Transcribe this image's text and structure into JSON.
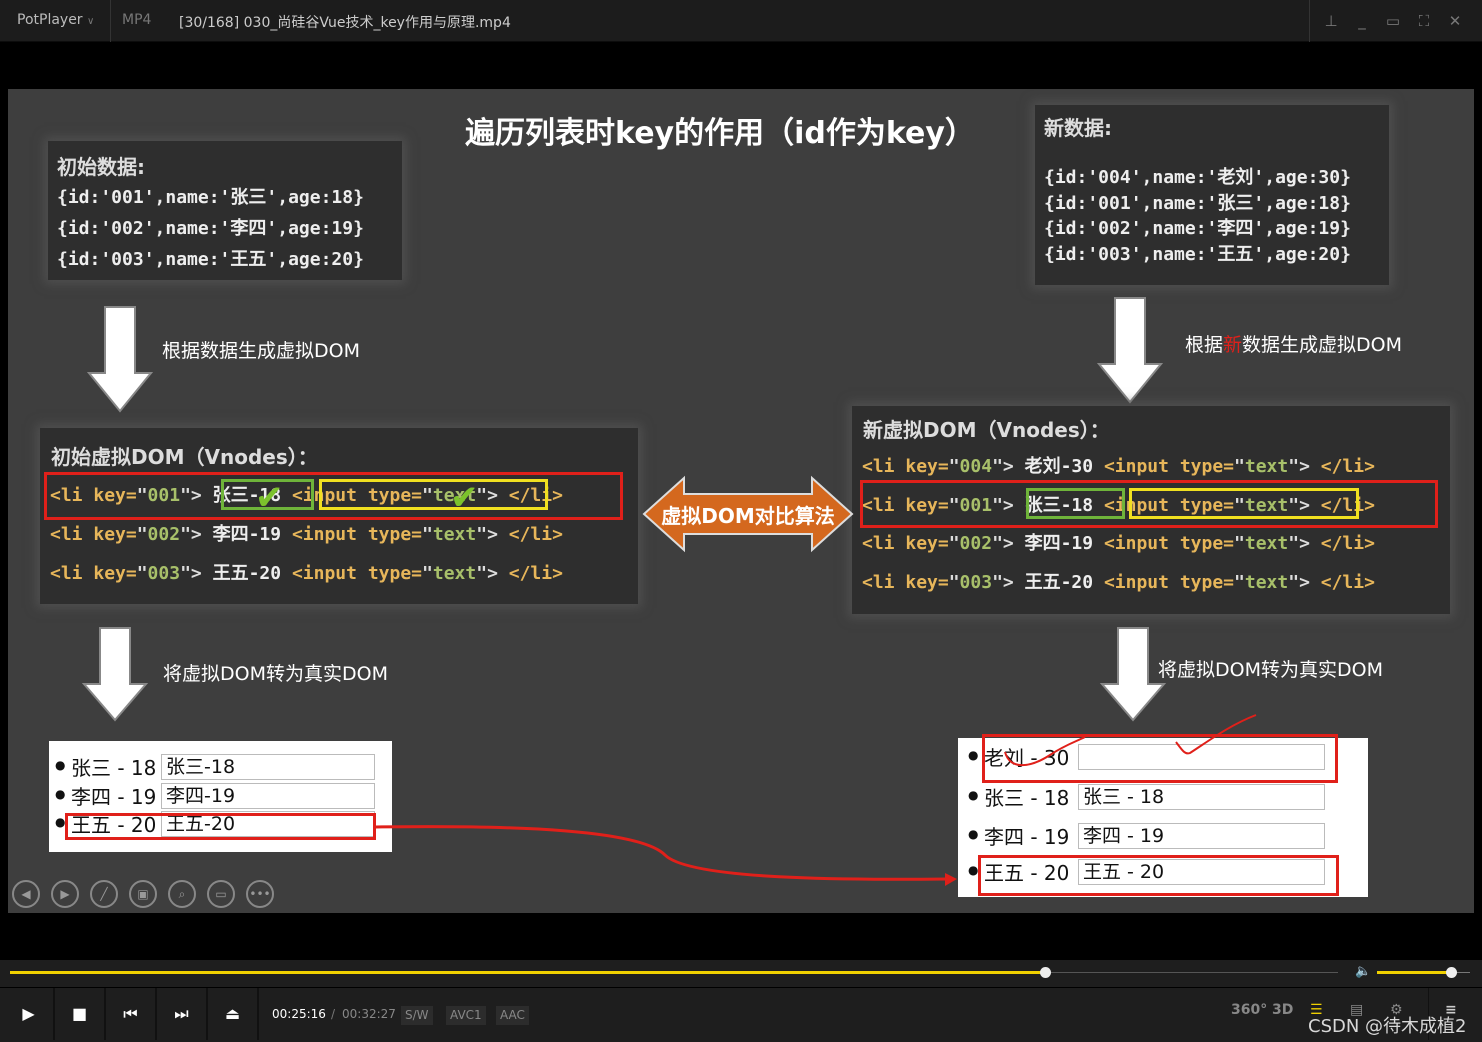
{
  "titlebar": {
    "app": "PotPlayer",
    "format": "MP4",
    "file": "[30/168] 030_尚硅谷Vue技术_key作用与原理.mp4"
  },
  "slide": {
    "title": "遍历列表时key的作用（id作为key）",
    "initial_data": {
      "label": "初始数据:",
      "rows": [
        "{id:'001',name:'张三',age:18}",
        "{id:'002',name:'李四',age:19}",
        "{id:'003',name:'王五',age:20}"
      ]
    },
    "new_data": {
      "label": "新数据:",
      "rows": [
        "{id:'004',name:'老刘',age:30}",
        "{id:'001',name:'张三',age:18}",
        "{id:'002',name:'李四',age:19}",
        "{id:'003',name:'王五',age:20}"
      ]
    },
    "arrow_left_1": "根据数据生成虚拟DOM",
    "arrow_right_1": {
      "pre": "根据",
      "highlight": "新",
      "post": "数据生成虚拟DOM"
    },
    "arrow_left_2": "将虚拟DOM转为真实DOM",
    "arrow_right_2": "将虚拟DOM转为真实DOM",
    "compare_label": "虚拟DOM对比算法",
    "tokens": {
      "li_open": "<li",
      "key_attr": " key=",
      "q": "\"",
      "close": ">",
      "input_open": "<input",
      "type_attr": " type=",
      "type_val": "text",
      "li_close": "</li>"
    },
    "initial_vdom": {
      "label": "初始虚拟DOM（Vnodes）：",
      "rows": [
        {
          "key": "001",
          "text": "张三-18"
        },
        {
          "key": "002",
          "text": "李四-19"
        },
        {
          "key": "003",
          "text": "王五-20"
        }
      ]
    },
    "new_vdom": {
      "label": "新虚拟DOM（Vnodes）：",
      "rows": [
        {
          "key": "004",
          "text": "老刘-30"
        },
        {
          "key": "001",
          "text": "张三-18"
        },
        {
          "key": "002",
          "text": "李四-19"
        },
        {
          "key": "003",
          "text": "王五-20"
        }
      ]
    },
    "initial_real": [
      {
        "label": "张三 - 18",
        "input": "张三-18"
      },
      {
        "label": "李四 - 19",
        "input": "李四-19"
      },
      {
        "label": "王五 - 20",
        "input": "王五-20"
      }
    ],
    "new_real": [
      {
        "label": "老刘 - 30",
        "input": ""
      },
      {
        "label": "张三 - 18",
        "input": "张三 - 18"
      },
      {
        "label": "李四 - 19",
        "input": "李四 - 19"
      },
      {
        "label": "王五 - 20",
        "input": "王五 - 20"
      }
    ],
    "nav_icons": [
      "prev-icon",
      "next-icon",
      "pen-icon",
      "slides-icon",
      "zoom-icon",
      "subtitle-icon",
      "more-icon"
    ]
  },
  "player": {
    "current_time": "00:25:16",
    "separator": "/",
    "total_time": "00:32:27",
    "progress": 0.779,
    "volume": 0.8,
    "badges": [
      "S/W",
      "AVC1",
      "AAC"
    ],
    "right_icons": [
      "360°",
      "3D"
    ],
    "watermark": "CSDN @待木成植2"
  },
  "colors": {
    "accent": "#f0d000",
    "highlight_red": "#e0201a",
    "green_box": "#6fb43a",
    "yellow_box": "#f0e020",
    "compare_arrow": "#d4681e",
    "tag": "#e7b65a",
    "value": "#a8c06a"
  }
}
